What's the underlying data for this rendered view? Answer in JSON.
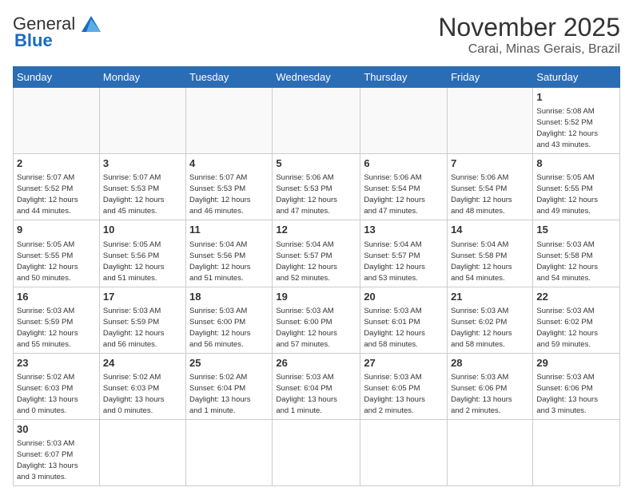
{
  "header": {
    "logo_general": "General",
    "logo_blue": "Blue",
    "month_title": "November 2025",
    "location": "Carai, Minas Gerais, Brazil"
  },
  "days_of_week": [
    "Sunday",
    "Monday",
    "Tuesday",
    "Wednesday",
    "Thursday",
    "Friday",
    "Saturday"
  ],
  "weeks": [
    [
      {
        "day": "",
        "info": ""
      },
      {
        "day": "",
        "info": ""
      },
      {
        "day": "",
        "info": ""
      },
      {
        "day": "",
        "info": ""
      },
      {
        "day": "",
        "info": ""
      },
      {
        "day": "",
        "info": ""
      },
      {
        "day": "1",
        "info": "Sunrise: 5:08 AM\nSunset: 5:52 PM\nDaylight: 12 hours\nand 43 minutes."
      }
    ],
    [
      {
        "day": "2",
        "info": "Sunrise: 5:07 AM\nSunset: 5:52 PM\nDaylight: 12 hours\nand 44 minutes."
      },
      {
        "day": "3",
        "info": "Sunrise: 5:07 AM\nSunset: 5:53 PM\nDaylight: 12 hours\nand 45 minutes."
      },
      {
        "day": "4",
        "info": "Sunrise: 5:07 AM\nSunset: 5:53 PM\nDaylight: 12 hours\nand 46 minutes."
      },
      {
        "day": "5",
        "info": "Sunrise: 5:06 AM\nSunset: 5:53 PM\nDaylight: 12 hours\nand 47 minutes."
      },
      {
        "day": "6",
        "info": "Sunrise: 5:06 AM\nSunset: 5:54 PM\nDaylight: 12 hours\nand 47 minutes."
      },
      {
        "day": "7",
        "info": "Sunrise: 5:06 AM\nSunset: 5:54 PM\nDaylight: 12 hours\nand 48 minutes."
      },
      {
        "day": "8",
        "info": "Sunrise: 5:05 AM\nSunset: 5:55 PM\nDaylight: 12 hours\nand 49 minutes."
      }
    ],
    [
      {
        "day": "9",
        "info": "Sunrise: 5:05 AM\nSunset: 5:55 PM\nDaylight: 12 hours\nand 50 minutes."
      },
      {
        "day": "10",
        "info": "Sunrise: 5:05 AM\nSunset: 5:56 PM\nDaylight: 12 hours\nand 51 minutes."
      },
      {
        "day": "11",
        "info": "Sunrise: 5:04 AM\nSunset: 5:56 PM\nDaylight: 12 hours\nand 51 minutes."
      },
      {
        "day": "12",
        "info": "Sunrise: 5:04 AM\nSunset: 5:57 PM\nDaylight: 12 hours\nand 52 minutes."
      },
      {
        "day": "13",
        "info": "Sunrise: 5:04 AM\nSunset: 5:57 PM\nDaylight: 12 hours\nand 53 minutes."
      },
      {
        "day": "14",
        "info": "Sunrise: 5:04 AM\nSunset: 5:58 PM\nDaylight: 12 hours\nand 54 minutes."
      },
      {
        "day": "15",
        "info": "Sunrise: 5:03 AM\nSunset: 5:58 PM\nDaylight: 12 hours\nand 54 minutes."
      }
    ],
    [
      {
        "day": "16",
        "info": "Sunrise: 5:03 AM\nSunset: 5:59 PM\nDaylight: 12 hours\nand 55 minutes."
      },
      {
        "day": "17",
        "info": "Sunrise: 5:03 AM\nSunset: 5:59 PM\nDaylight: 12 hours\nand 56 minutes."
      },
      {
        "day": "18",
        "info": "Sunrise: 5:03 AM\nSunset: 6:00 PM\nDaylight: 12 hours\nand 56 minutes."
      },
      {
        "day": "19",
        "info": "Sunrise: 5:03 AM\nSunset: 6:00 PM\nDaylight: 12 hours\nand 57 minutes."
      },
      {
        "day": "20",
        "info": "Sunrise: 5:03 AM\nSunset: 6:01 PM\nDaylight: 12 hours\nand 58 minutes."
      },
      {
        "day": "21",
        "info": "Sunrise: 5:03 AM\nSunset: 6:02 PM\nDaylight: 12 hours\nand 58 minutes."
      },
      {
        "day": "22",
        "info": "Sunrise: 5:03 AM\nSunset: 6:02 PM\nDaylight: 12 hours\nand 59 minutes."
      }
    ],
    [
      {
        "day": "23",
        "info": "Sunrise: 5:02 AM\nSunset: 6:03 PM\nDaylight: 13 hours\nand 0 minutes."
      },
      {
        "day": "24",
        "info": "Sunrise: 5:02 AM\nSunset: 6:03 PM\nDaylight: 13 hours\nand 0 minutes."
      },
      {
        "day": "25",
        "info": "Sunrise: 5:02 AM\nSunset: 6:04 PM\nDaylight: 13 hours\nand 1 minute."
      },
      {
        "day": "26",
        "info": "Sunrise: 5:03 AM\nSunset: 6:04 PM\nDaylight: 13 hours\nand 1 minute."
      },
      {
        "day": "27",
        "info": "Sunrise: 5:03 AM\nSunset: 6:05 PM\nDaylight: 13 hours\nand 2 minutes."
      },
      {
        "day": "28",
        "info": "Sunrise: 5:03 AM\nSunset: 6:06 PM\nDaylight: 13 hours\nand 2 minutes."
      },
      {
        "day": "29",
        "info": "Sunrise: 5:03 AM\nSunset: 6:06 PM\nDaylight: 13 hours\nand 3 minutes."
      }
    ],
    [
      {
        "day": "30",
        "info": "Sunrise: 5:03 AM\nSunset: 6:07 PM\nDaylight: 13 hours\nand 3 minutes."
      },
      {
        "day": "",
        "info": ""
      },
      {
        "day": "",
        "info": ""
      },
      {
        "day": "",
        "info": ""
      },
      {
        "day": "",
        "info": ""
      },
      {
        "day": "",
        "info": ""
      },
      {
        "day": "",
        "info": ""
      }
    ]
  ]
}
